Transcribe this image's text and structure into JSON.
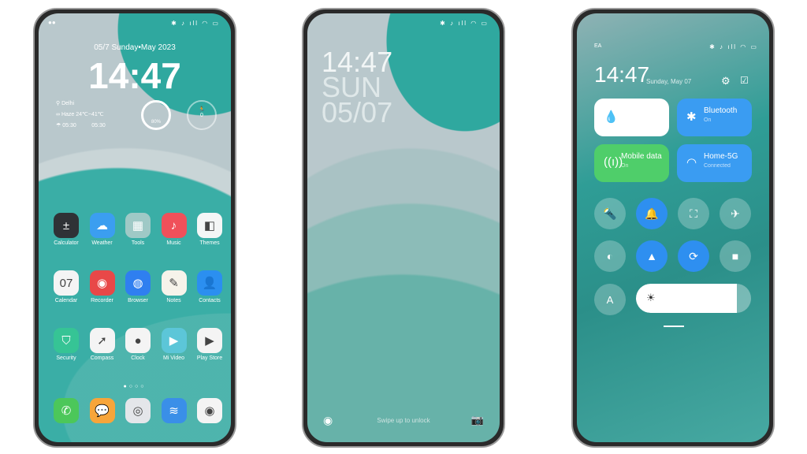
{
  "home": {
    "status_icons": "✱ ♪ ıll ◠ ▭",
    "date": "05/7  Sunday•May 2023",
    "time": "14:47",
    "city": "Delhi",
    "weather": "Haze  24℃~41℃",
    "sunrise": "05:30",
    "sunset": "05:30",
    "battery": "80%",
    "steps": "0",
    "apps": [
      {
        "label": "Calculator",
        "icon": "calculator-icon",
        "glyph": "±",
        "bg": "#2f3236"
      },
      {
        "label": "Weather",
        "icon": "weather-icon",
        "glyph": "☁",
        "bg": "#3b9ef0"
      },
      {
        "label": "Tools",
        "icon": "tools-folder-icon",
        "glyph": "▦",
        "bg": "#9fc9c6"
      },
      {
        "label": "Music",
        "icon": "music-icon",
        "glyph": "♪",
        "bg": "#f0505a"
      },
      {
        "label": "Themes",
        "icon": "themes-icon",
        "glyph": "◧",
        "bg": "#f4f6f6"
      },
      {
        "label": "Calendar",
        "icon": "calendar-icon",
        "glyph": "07",
        "bg": "#f4f4f4"
      },
      {
        "label": "Recorder",
        "icon": "recorder-icon",
        "glyph": "◉",
        "bg": "#e84848"
      },
      {
        "label": "Browser",
        "icon": "browser-icon",
        "glyph": "◍",
        "bg": "#2f7ff0"
      },
      {
        "label": "Notes",
        "icon": "notes-icon",
        "glyph": "✎",
        "bg": "#f6f3ea"
      },
      {
        "label": "Contacts",
        "icon": "contacts-icon",
        "glyph": "👤",
        "bg": "#2b8ff0"
      },
      {
        "label": "Security",
        "icon": "security-icon",
        "glyph": "⛉",
        "bg": "#36c495"
      },
      {
        "label": "Compass",
        "icon": "compass-icon",
        "glyph": "➚",
        "bg": "#f4f4f4"
      },
      {
        "label": "Clock",
        "icon": "clock-icon",
        "glyph": "●",
        "bg": "#f4f4f4"
      },
      {
        "label": "Mi Video",
        "icon": "video-icon",
        "glyph": "▶",
        "bg": "#5cc6d8"
      },
      {
        "label": "Play Store",
        "icon": "play-store-icon",
        "glyph": "▶",
        "bg": "#f4f4f4"
      }
    ],
    "dock": [
      {
        "icon": "phone-icon",
        "glyph": "✆",
        "bg": "#4cc75a"
      },
      {
        "icon": "messages-icon",
        "glyph": "💬",
        "bg": "#f7a53a"
      },
      {
        "icon": "settings-icon",
        "glyph": "◎",
        "bg": "#e4e6ea"
      },
      {
        "icon": "gallery-icon",
        "glyph": "≋",
        "bg": "#3a8fe8"
      },
      {
        "icon": "camera-icon",
        "glyph": "◉",
        "bg": "#f4f4f4"
      }
    ]
  },
  "lock": {
    "time": "14:47",
    "day": "SUN",
    "date": "05/07",
    "hint": "Swipe up to unlock"
  },
  "control": {
    "carrier": "EA",
    "time": "14:47",
    "date": "Sunday, May 07",
    "tiles": [
      {
        "label": "",
        "sub": "",
        "icon": "water-drop-icon",
        "glyph": "💧",
        "bg": "#ffffff",
        "fg": "#2e8ff0"
      },
      {
        "label": "Bluetooth",
        "sub": "On",
        "icon": "bluetooth-icon",
        "glyph": "✱",
        "bg": "#3a9cf2",
        "fg": "#fff"
      },
      {
        "label": "Mobile data",
        "sub": "On",
        "icon": "mobile-data-icon",
        "glyph": "((ı))",
        "bg": "#4fce6a",
        "fg": "#fff"
      },
      {
        "label": "Home-5G",
        "sub": "Connected",
        "icon": "wifi-icon",
        "glyph": "◠",
        "bg": "#3a9cf2",
        "fg": "#fff"
      }
    ],
    "toggles": [
      {
        "icon": "flashlight-icon",
        "glyph": "🔦",
        "on": false
      },
      {
        "icon": "bell-icon",
        "glyph": "🔔",
        "on": true
      },
      {
        "icon": "screenshot-icon",
        "glyph": "⛶",
        "on": false
      },
      {
        "icon": "airplane-icon",
        "glyph": "✈",
        "on": false
      },
      {
        "icon": "dark-mode-icon",
        "glyph": "◐",
        "on": false
      },
      {
        "icon": "location-icon",
        "glyph": "▲",
        "on": true
      },
      {
        "icon": "rotation-lock-icon",
        "glyph": "⟳",
        "on": true
      },
      {
        "icon": "screen-record-icon",
        "glyph": "■",
        "on": false
      }
    ],
    "auto_brightness": "A",
    "brightness_percent": 88
  }
}
